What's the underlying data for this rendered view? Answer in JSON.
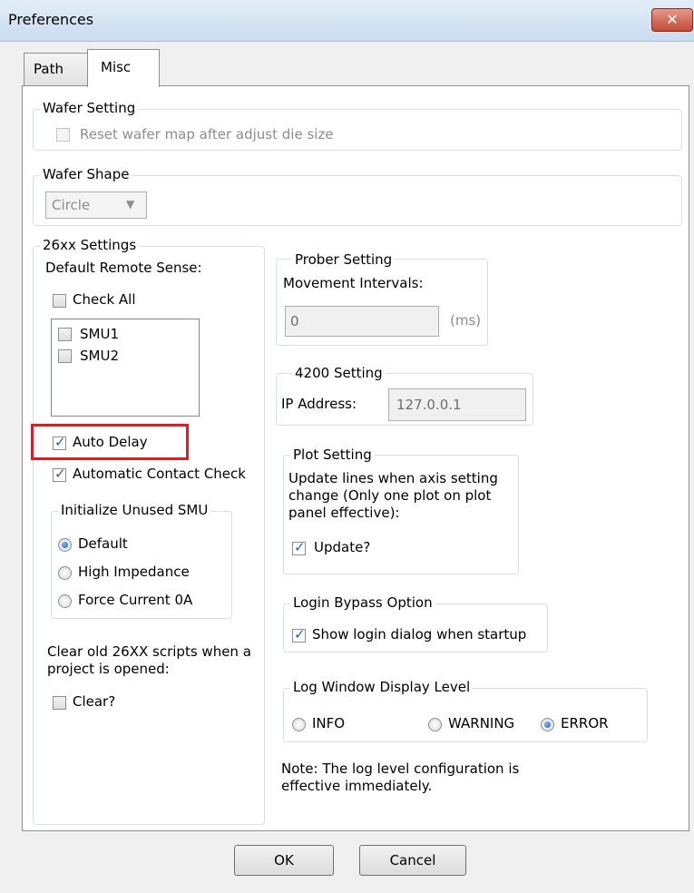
{
  "window": {
    "title": "Preferences",
    "close_glyph": "✕"
  },
  "tabs": [
    {
      "label": "Path"
    },
    {
      "label": "Misc"
    }
  ],
  "wafer_setting": {
    "title": "Wafer Setting",
    "reset_label": "Reset wafer map after adjust die size",
    "reset_checked": false
  },
  "wafer_shape": {
    "title": "Wafer Shape",
    "value": "Circle"
  },
  "s26xx": {
    "title": "26xx Settings",
    "remote_sense_label": "Default Remote Sense:",
    "check_all_label": "Check All",
    "smus": [
      {
        "label": "SMU1"
      },
      {
        "label": "SMU2"
      }
    ],
    "auto_delay_label": "Auto Delay",
    "auto_contact_label": "Automatic Contact Check",
    "unused_smu": {
      "title": "Initialize Unused SMU",
      "options": [
        {
          "label": "Default",
          "selected": true
        },
        {
          "label": "High Impedance"
        },
        {
          "label": "Force Current 0A"
        }
      ]
    },
    "clear_text": "Clear old 26XX scripts when a project is opened:",
    "clear_label": "Clear?"
  },
  "prober": {
    "title": "Prober Setting",
    "label": "Movement Intervals:",
    "value": "0",
    "unit": "(ms)"
  },
  "s4200": {
    "title": "4200 Setting",
    "label": "IP Address:",
    "value": "127.0.0.1"
  },
  "plot": {
    "title": "Plot Setting",
    "text": "Update lines when axis setting change (Only one plot on plot panel effective):",
    "update_label": "Update?"
  },
  "login": {
    "title": "Login Bypass Option",
    "label": "Show login dialog when startup"
  },
  "log": {
    "title": "Log Window Display Level",
    "options": [
      {
        "label": "INFO"
      },
      {
        "label": "WARNING"
      },
      {
        "label": "ERROR",
        "selected": true
      }
    ],
    "note": "Note: The log level configuration is effective immediately."
  },
  "buttons": {
    "ok": "OK",
    "cancel": "Cancel"
  },
  "colors": {
    "highlight": "#e01b24",
    "check": "#2a5fae"
  }
}
